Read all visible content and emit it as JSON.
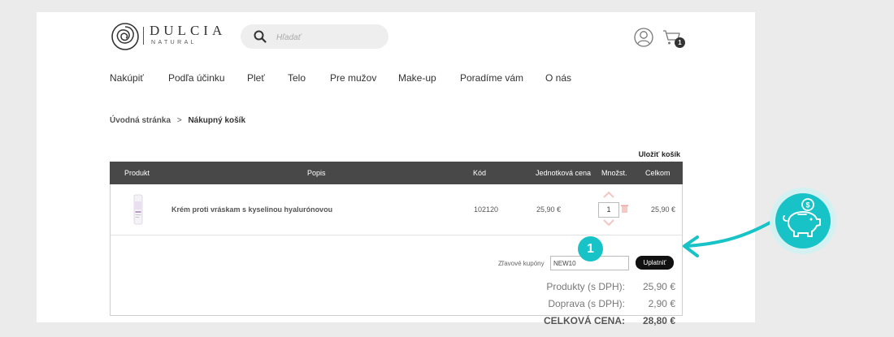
{
  "header": {
    "brand": "DULCIA",
    "brand_sub": "NATURAL",
    "search_placeholder": "Hľadať",
    "cart_count": "1"
  },
  "nav": [
    "Nakúpiť",
    "Podľa účinku",
    "Pleť",
    "Telo",
    "Pre mužov",
    "Make-up",
    "Poradíme vám",
    "O nás"
  ],
  "breadcrumb": {
    "home": "Úvodná stránka",
    "separator": ">",
    "current": "Nákupný košík"
  },
  "save_cart": "Uložiť košík",
  "table": {
    "headers": {
      "product": "Produkt",
      "description": "Popis",
      "code": "Kód",
      "unit_price": "Jednotková cena",
      "qty": "Množst.",
      "total": "Celkom"
    },
    "rows": [
      {
        "name": "Krém proti vráskam s kyselinou hyalurónovou",
        "code": "102120",
        "unit_price": "25,90 €",
        "qty": "1",
        "total": "25,90 €"
      }
    ]
  },
  "coupon": {
    "label": "Zľavové kupóny",
    "value": "NEW10",
    "apply_label": "Uplatniť"
  },
  "summary": {
    "products_label": "Produkty (s DPH):",
    "products_value": "25,90 €",
    "shipping_label": "Doprava (s DPH):",
    "shipping_value": "2,90 €",
    "total_label": "CELKOVÁ CENA:",
    "total_value": "28,80 €"
  },
  "annotation": {
    "step": "1"
  },
  "colors": {
    "accent": "#17c3c6",
    "header_bg": "#484848",
    "apply_bg": "#111111",
    "page_bg": "#ebebeb"
  },
  "icons": [
    "logo-rose-icon",
    "search-icon",
    "user-icon",
    "cart-icon",
    "chevron-up-icon",
    "chevron-down-icon",
    "trash-icon",
    "piggy-bank-icon",
    "arrow-icon"
  ]
}
